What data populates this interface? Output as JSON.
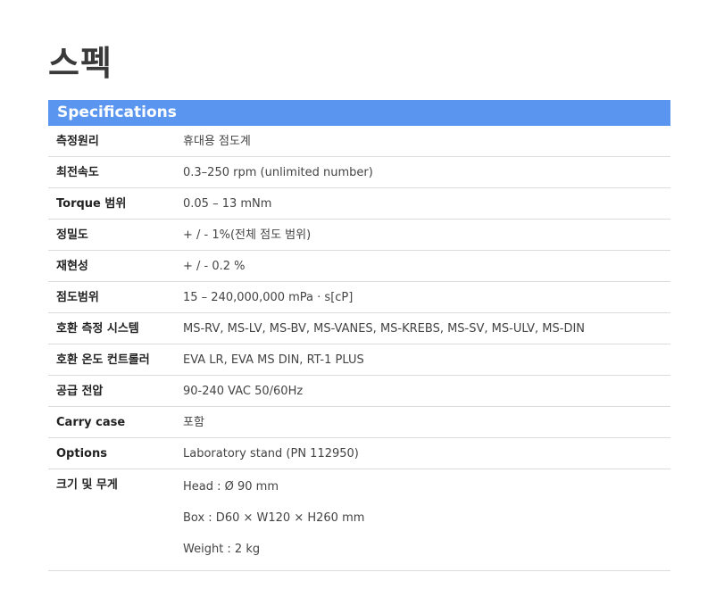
{
  "page": {
    "title": "스펙"
  },
  "spec_table": {
    "header": "Specifications",
    "rows": [
      {
        "label": "측정원리",
        "value": "휴대용 점도계"
      },
      {
        "label": "최전속도",
        "value": "0.3–250 rpm (unlimited number)"
      },
      {
        "label": "Torque 범위",
        "value": "0.05 – 13 mNm"
      },
      {
        "label": "정밀도",
        "value": "+ / - 1%(전체 점도 범위)"
      },
      {
        "label": "재현성",
        "value": "+ / - 0.2 %"
      },
      {
        "label": "점도범위",
        "value": "15 – 240,000,000 mPa · s[cP]"
      },
      {
        "label": "호환 측정 시스템",
        "value": "MS-RV, MS-LV, MS-BV, MS-VANES, MS-KREBS, MS-SV, MS-ULV, MS-DIN"
      },
      {
        "label": "호환 온도 컨트롤러",
        "value": "EVA LR, EVA MS DIN, RT-1 PLUS"
      },
      {
        "label": "공급 전압",
        "value": "90-240 VAC 50/60Hz"
      },
      {
        "label": "Carry case",
        "value": "포함"
      },
      {
        "label": "Options",
        "value": "Laboratory stand (PN 112950)"
      }
    ],
    "size_weight": {
      "label": "크기 및 무게",
      "values": [
        "Head : Ø 90 mm",
        "Box : D60 × W120 × H260 mm",
        "Weight : 2 kg"
      ]
    }
  },
  "colors": {
    "header_bg": "#5a96f0",
    "header_text": "#ffffff",
    "divider": "#dcdcdc"
  }
}
